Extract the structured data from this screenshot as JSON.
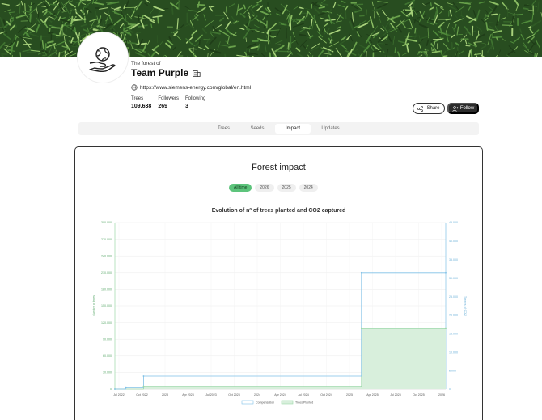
{
  "profile": {
    "pre_title": "The forest of",
    "name": "Team Purple",
    "website": "https://www.siemens-energy.com/global/en.html",
    "stats": [
      {
        "label": "Trees",
        "value": "109.638"
      },
      {
        "label": "Followers",
        "value": "269"
      },
      {
        "label": "Following",
        "value": "3"
      }
    ]
  },
  "actions": {
    "share_label": "Share",
    "follow_label": "Follow"
  },
  "tabs": [
    {
      "label": "Trees"
    },
    {
      "label": "Seeds"
    },
    {
      "label": "Impact"
    },
    {
      "label": "Updates"
    }
  ],
  "active_tab": "Impact",
  "impact": {
    "title": "Forest impact",
    "filters": [
      {
        "label": "All time"
      },
      {
        "label": "2026"
      },
      {
        "label": "2025"
      },
      {
        "label": "2024"
      }
    ],
    "active_filter": "All time"
  },
  "colors": {
    "compensation": "#7fc0e6",
    "trees_planted": "#9bd7a8",
    "trees_planted_fill": "#d8efdc",
    "active_filter": "#5dc47c"
  },
  "chart_data": {
    "type": "area",
    "title": "Evolution of nº of trees planted and CO2 captured",
    "xlabel": "",
    "y_left_label": "Number of trees",
    "y_right_label": "Tonnes of CO2",
    "x_ticks": [
      "Jul 2022",
      "Oct 2022",
      "2023",
      "Apr 2023",
      "Jul 2023",
      "Oct 2023",
      "2024",
      "Apr 2024",
      "Jul 2024",
      "Oct 2024",
      "2025",
      "Apr 2025",
      "Jul 2025",
      "Oct 2025",
      "2026"
    ],
    "y_left_ticks": [
      "0",
      "30.000",
      "60.000",
      "90.000",
      "120.000",
      "150.000",
      "180.000",
      "210.000",
      "240.000",
      "270.000",
      "300.000"
    ],
    "y_right_ticks": [
      "0",
      "5.000",
      "10.000",
      "15.000",
      "20.000",
      "25.000",
      "30.000",
      "35.000",
      "40.000",
      "45.000"
    ],
    "y_left_range": [
      0,
      300000
    ],
    "y_right_range": [
      0,
      45000
    ],
    "x_range": [
      "2022-07-01",
      "2026-03-01"
    ],
    "grid": true,
    "legend_placement": "bottom",
    "series": [
      {
        "name": "Compensation",
        "axis": "right",
        "points": [
          {
            "x": "2022-07-01",
            "y": 0
          },
          {
            "x": "2022-08-15",
            "y": 500
          },
          {
            "x": "2022-10-25",
            "y": 3500
          },
          {
            "x": "2025-03-25",
            "y": 31500
          }
        ]
      },
      {
        "name": "Trees Planted",
        "axis": "left",
        "points": [
          {
            "x": "2022-07-01",
            "y": 0
          },
          {
            "x": "2022-10-25",
            "y": 5000
          },
          {
            "x": "2025-03-25",
            "y": 110000
          }
        ]
      }
    ]
  }
}
